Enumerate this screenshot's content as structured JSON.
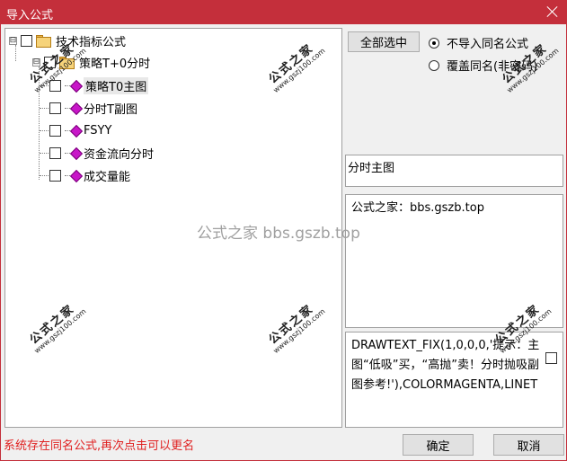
{
  "window": {
    "title": "导入公式"
  },
  "tree": {
    "root": {
      "label": "技术指标公式",
      "expander": "⊟"
    },
    "group": {
      "label": "策略T+0分时",
      "expander": "⊟"
    },
    "items": [
      {
        "label": "策略T0主图",
        "selected": true
      },
      {
        "label": "分时T副图"
      },
      {
        "label": "FSYY"
      },
      {
        "label": "资金流向分时"
      },
      {
        "label": "成交量能"
      }
    ]
  },
  "buttons": {
    "select_all": "全部选中",
    "ok": "确定",
    "cancel": "取消"
  },
  "radios": {
    "skip_same": "不导入同名公式",
    "overwrite_same": "覆盖同名(非密码)",
    "selected": "skip_same"
  },
  "panels": {
    "type_text": "分时主图",
    "description": "公式之家：bbs.gszb.top",
    "code": "DRAWTEXT_FIX(1,0,0,0,'提示：主图“低吸”买，“高抛”卖！分时抛吸副图参考!'),COLORMAGENTA,LINET"
  },
  "status": "系统存在同名公式,再次点击可以更名",
  "watermark": {
    "center": "公式之家 bbs.gszb.top",
    "stamp_title": "公式之家",
    "stamp_url": "www.gszj100.com"
  },
  "colors": {
    "titlebar": "#c42f3b",
    "status_text": "#e02020",
    "gem": "#c816c8"
  }
}
